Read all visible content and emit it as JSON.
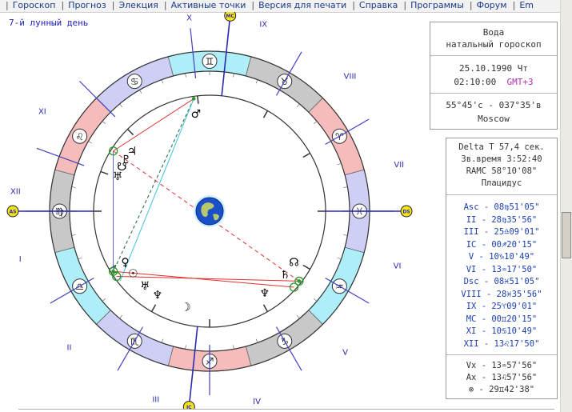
{
  "menu": {
    "items": [
      {
        "label": "Гороскоп"
      },
      {
        "label": "Прогноз"
      },
      {
        "label": "Элекция"
      },
      {
        "label": "Активные точки"
      },
      {
        "label": "Версия для печати"
      },
      {
        "label": "Справка"
      },
      {
        "label": "Программы"
      },
      {
        "label": "Форум"
      },
      {
        "label": "Em"
      }
    ]
  },
  "lunar_day": "7-й лунный день",
  "chart": {
    "house_numerals": [
      {
        "label": "I",
        "lon": 180
      },
      {
        "label": "II",
        "lon": 210
      },
      {
        "label": "III",
        "lon": 240
      },
      {
        "label": "IV",
        "lon": 270
      },
      {
        "label": "V",
        "lon": 300
      },
      {
        "label": "VI",
        "lon": 330
      },
      {
        "label": "VII",
        "lon": 0
      },
      {
        "label": "VIII",
        "lon": 30
      },
      {
        "label": "IX",
        "lon": 60
      },
      {
        "label": "X",
        "lon": 96
      },
      {
        "label": "XI",
        "lon": 135
      },
      {
        "label": "XII",
        "lon": 160
      }
    ],
    "angle_markers": [
      {
        "label": "AS",
        "lon": 180
      },
      {
        "label": "DS",
        "lon": 0
      },
      {
        "label": "MC",
        "lon": 84
      },
      {
        "label": "IC",
        "lon": 264
      }
    ],
    "sign_band": [
      {
        "glyph": "♍",
        "lon": 180,
        "color": "#c8c8c8"
      },
      {
        "glyph": "♌",
        "lon": 150,
        "color": "#f6bcbc"
      },
      {
        "glyph": "♋",
        "lon": 120,
        "color": "#cfcff5"
      },
      {
        "glyph": "♊",
        "lon": 90,
        "color": "#aeeef8"
      },
      {
        "glyph": "♉",
        "lon": 60,
        "color": "#c8c8c8"
      },
      {
        "glyph": "♈",
        "lon": 30,
        "color": "#f6bcbc"
      },
      {
        "glyph": "♓",
        "lon": 0,
        "color": "#cfcff5"
      },
      {
        "glyph": "♒",
        "lon": 330,
        "color": "#aeeef8"
      },
      {
        "glyph": "♑",
        "lon": 300,
        "color": "#c8c8c8"
      },
      {
        "glyph": "♐",
        "lon": 270,
        "color": "#f6bcbc"
      },
      {
        "glyph": "♏",
        "lon": 240,
        "color": "#cfcff5"
      },
      {
        "glyph": "♎",
        "lon": 210,
        "color": "#aeeef8"
      }
    ],
    "planets": [
      {
        "glyph": "♂",
        "lon": 98,
        "color": "#000000"
      },
      {
        "glyph": "♇",
        "lon": 148,
        "color": "#000000"
      },
      {
        "glyph": "☋",
        "lon": 153,
        "color": "#000000"
      },
      {
        "glyph": "♅",
        "lon": 159,
        "color": "#000000"
      },
      {
        "glyph": "♃",
        "lon": 142,
        "color": "#000000"
      },
      {
        "glyph": "♀",
        "lon": 211,
        "color": "#000000"
      },
      {
        "glyph": "☉",
        "lon": 219,
        "color": "#000000"
      },
      {
        "glyph": "♅",
        "lon": 229,
        "color": "#000000"
      },
      {
        "glyph": "♆",
        "lon": 238,
        "color": "#000000"
      },
      {
        "glyph": "☽",
        "lon": 256,
        "color": "#000000"
      },
      {
        "glyph": "☊",
        "lon": 329,
        "color": "#000000"
      },
      {
        "glyph": "♄",
        "lon": 320,
        "color": "#000000"
      },
      {
        "glyph": "♆",
        "lon": 304,
        "color": "#000000"
      }
    ]
  },
  "info_panel": {
    "title_line1": "Вода",
    "title_line2": "натальный гороскоп",
    "date": "25.10.1990 Чт",
    "time": "02:10:00",
    "tz": "GMT+3",
    "coords": "55°45'с - 037°35'в",
    "city": "Moscow"
  },
  "data_panel": {
    "delta_t": "Delta T   57,4 сек.",
    "star_time": "Зв.время 3:52:40",
    "ramc": "RAMC 58°10'08\"",
    "house_system": "Плацидус",
    "cusps": [
      "Asc - 08♍51'05\"",
      "II - 28♍35'56\"",
      "III - 25♎09'01\"",
      "IC - 00♐20'15\"",
      "V - 10♑10'49\"",
      "VI - 13♒17'50\"",
      "Dsc - 08♓51'05\"",
      "VIII - 28♓35'56\"",
      "IX - 25♈09'01\"",
      "MC - 00♊20'15\"",
      "XI - 10♋10'49\"",
      "XII - 13♌17'50\""
    ],
    "points": [
      "Vx - 13♒57'56\"",
      "Ax - 13♌57'56\"",
      "⊗ - 29♊42'38\""
    ]
  }
}
